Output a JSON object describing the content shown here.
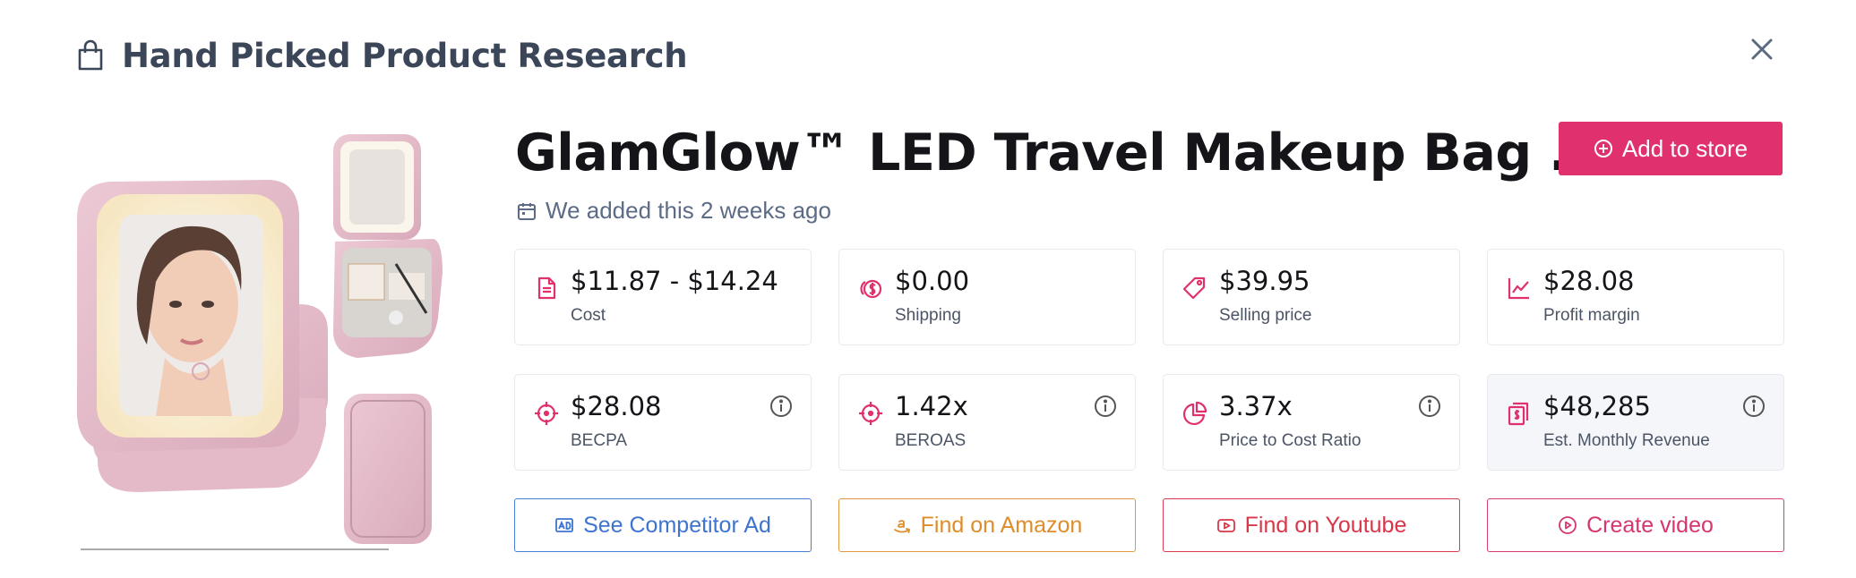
{
  "header": {
    "title": "Hand Picked Product Research",
    "icon": "shopping-bag-icon"
  },
  "product": {
    "title": "GlamGlow™ LED Travel Makeup Bag ...",
    "added_text": "We added this 2 weeks ago",
    "image": "pink-led-makeup-bag-photo"
  },
  "add_button": {
    "label": "Add to store",
    "color": "#e0316e"
  },
  "metrics": [
    {
      "value": "$11.87 - $14.24",
      "label": "Cost",
      "icon": "document-icon"
    },
    {
      "value": "$0.00",
      "label": "Shipping",
      "icon": "coins-icon"
    },
    {
      "value": "$39.95",
      "label": "Selling price",
      "icon": "price-tag-icon"
    },
    {
      "value": "$28.08",
      "label": "Profit margin",
      "icon": "line-chart-icon"
    },
    {
      "value": "$28.08",
      "label": "BECPA",
      "icon": "crosshair-icon"
    },
    {
      "value": "1.42x",
      "label": "BEROAS",
      "icon": "crosshair-icon"
    },
    {
      "value": "3.37x",
      "label": "Price to Cost Ratio",
      "icon": "pie-chart-icon"
    },
    {
      "value": "$48,285",
      "label": "Est. Monthly Revenue",
      "icon": "money-stack-icon"
    }
  ],
  "actions": [
    {
      "label": "See Competitor Ad",
      "icon": "ad-icon",
      "color": "#3d74d0"
    },
    {
      "label": "Find on Amazon",
      "icon": "amazon-icon",
      "color": "#df8d2a"
    },
    {
      "label": "Find on Youtube",
      "icon": "youtube-icon",
      "color": "#d9364a"
    },
    {
      "label": "Create video",
      "icon": "play-circle-icon",
      "color": "#d63570"
    }
  ],
  "colors": {
    "accent": "#e0316e",
    "text_muted": "#5c6b86",
    "card_border": "#e7e9ef"
  }
}
